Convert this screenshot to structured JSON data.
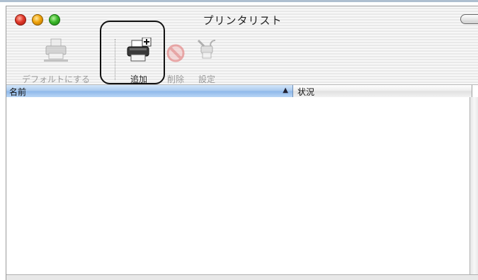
{
  "window": {
    "title": "プリンタリスト"
  },
  "toolbar": {
    "items": [
      {
        "id": "make_default",
        "label": "デフォルトにする",
        "icon": "printer-default-icon",
        "enabled": false
      },
      {
        "id": "add",
        "label": "追加",
        "icon": "printer-add-icon",
        "enabled": true,
        "highlighted": true
      },
      {
        "id": "delete",
        "label": "削除",
        "icon": "delete-icon",
        "enabled": false
      },
      {
        "id": "settings",
        "label": "設定",
        "icon": "settings-tools-icon",
        "enabled": false
      }
    ]
  },
  "table": {
    "columns": [
      {
        "label": "名前",
        "sorted": true,
        "sort_direction": "ascending"
      },
      {
        "label": "状況"
      }
    ],
    "rows": []
  },
  "colors": {
    "selected_header": "#a7c8ee",
    "close": "#e0382a",
    "minimize": "#f0a40a",
    "zoom": "#3bb82a"
  }
}
